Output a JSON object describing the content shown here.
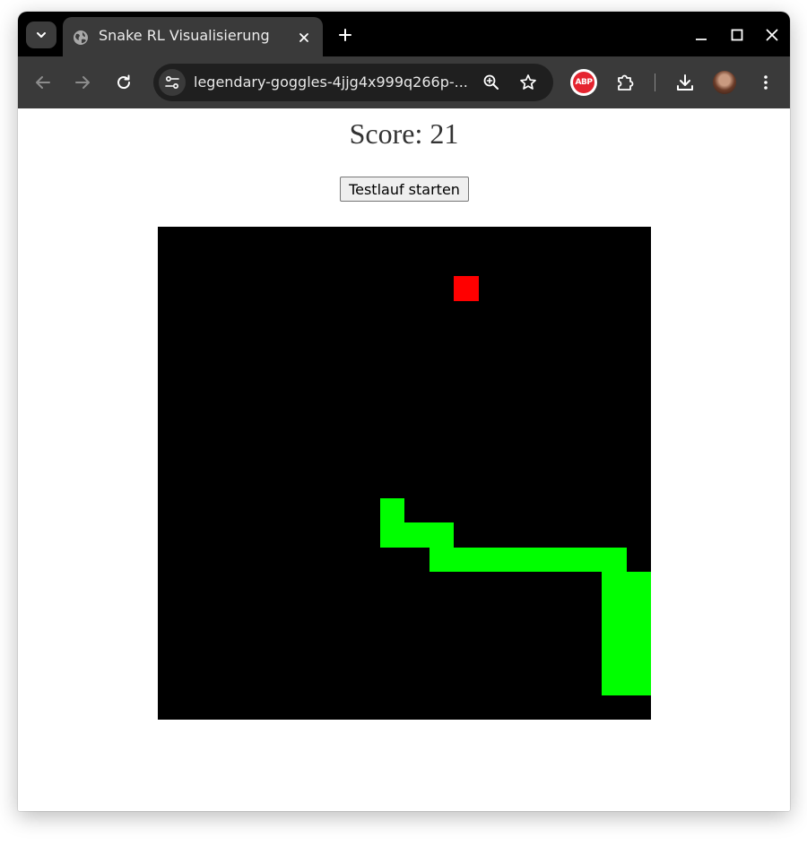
{
  "browser": {
    "tab": {
      "title": "Snake RL Visualisierung",
      "favicon": "globe-icon"
    },
    "address_bar": {
      "url": "legendary-goggles-4jjg4x999q266p-...",
      "site_info_icon": "tune-icon"
    },
    "extensions": {
      "adblock_label": "ABP"
    }
  },
  "page": {
    "score_text": "Score: 21",
    "start_button_label": "Testlauf starten"
  },
  "game": {
    "grid_size": 20,
    "colors": {
      "background": "#000000",
      "snake": "#00ff00",
      "food": "#ff0000"
    },
    "food": [
      12,
      2
    ],
    "snake": [
      [
        9,
        11
      ],
      [
        9,
        12
      ],
      [
        10,
        12
      ],
      [
        11,
        12
      ],
      [
        11,
        13
      ],
      [
        12,
        13
      ],
      [
        13,
        13
      ],
      [
        14,
        13
      ],
      [
        15,
        13
      ],
      [
        16,
        13
      ],
      [
        17,
        13
      ],
      [
        18,
        13
      ],
      [
        18,
        14
      ],
      [
        19,
        14
      ],
      [
        18,
        15
      ],
      [
        19,
        15
      ],
      [
        18,
        16
      ],
      [
        19,
        16
      ],
      [
        18,
        17
      ],
      [
        19,
        17
      ],
      [
        18,
        18
      ],
      [
        19,
        18
      ]
    ]
  }
}
